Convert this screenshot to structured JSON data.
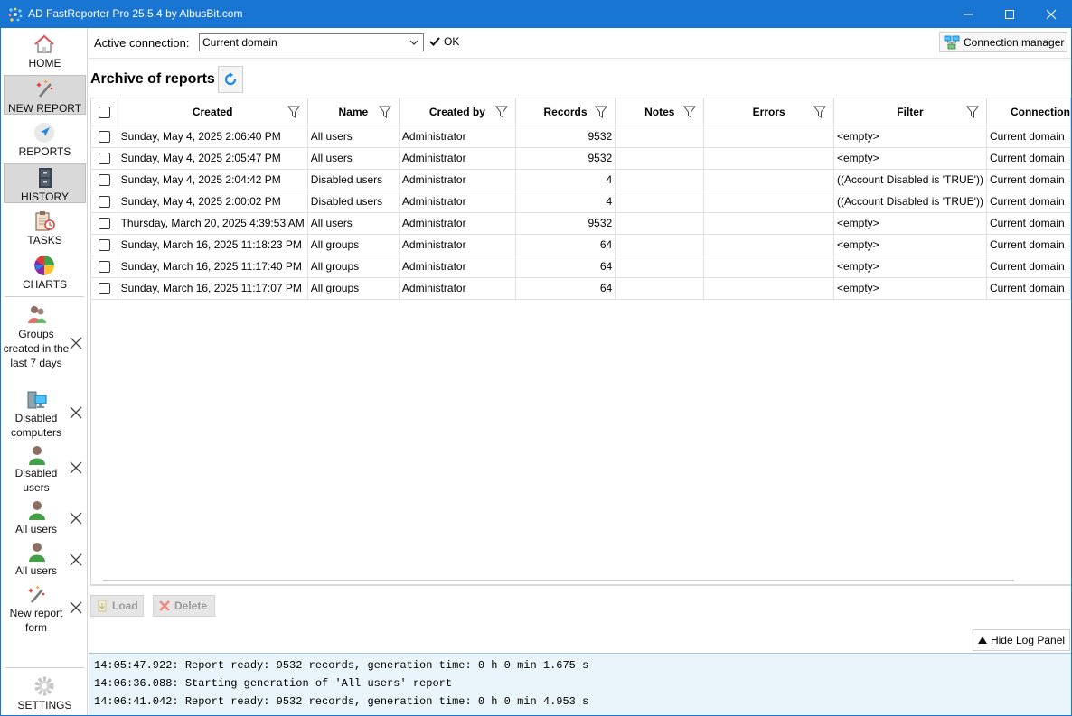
{
  "window": {
    "title": "AD FastReporter Pro 25.5.4 by AlbusBit.com"
  },
  "sidebar": {
    "nav": [
      {
        "label": "HOME",
        "icon": "home-icon",
        "active": false
      },
      {
        "label": "NEW REPORT",
        "icon": "magic-wand-icon",
        "active": true
      },
      {
        "label": "REPORTS",
        "icon": "navigation-arrow-icon",
        "active": false
      },
      {
        "label": "HISTORY",
        "icon": "file-cabinet-icon",
        "active": true
      },
      {
        "label": "TASKS",
        "icon": "clipboard-clock-icon",
        "active": false
      },
      {
        "label": "CHARTS",
        "icon": "pie-chart-icon",
        "active": false
      }
    ],
    "recent": [
      {
        "label": "Groups created in the last 7 days",
        "icon": "group-users-icon"
      },
      {
        "label": "Disabled computers",
        "icon": "computer-icon"
      },
      {
        "label": "Disabled users",
        "icon": "user-icon"
      },
      {
        "label": "All users",
        "icon": "user-icon"
      },
      {
        "label": "All users",
        "icon": "user-icon"
      },
      {
        "label": "New report form",
        "icon": "magic-wand-icon"
      }
    ],
    "settings_label": "SETTINGS"
  },
  "connection": {
    "label": "Active connection:",
    "value": "Current domain",
    "status": "OK",
    "manager_label": "Connection manager"
  },
  "archive": {
    "title": "Archive of reports"
  },
  "grid": {
    "columns": [
      "Created",
      "Name",
      "Created by",
      "Records",
      "Notes",
      "Errors",
      "Filter",
      "Connection"
    ],
    "rows": [
      {
        "created": "Sunday, May 4, 2025 2:06:40 PM",
        "name": "All users",
        "created_by": "Administrator",
        "records": "9532",
        "notes": "",
        "errors": "",
        "filter": "<empty>",
        "connection": "Current domain"
      },
      {
        "created": "Sunday, May 4, 2025 2:05:47 PM",
        "name": "All users",
        "created_by": "Administrator",
        "records": "9532",
        "notes": "",
        "errors": "",
        "filter": "<empty>",
        "connection": "Current domain"
      },
      {
        "created": "Sunday, May 4, 2025 2:04:42 PM",
        "name": "Disabled users",
        "created_by": "Administrator",
        "records": "4",
        "notes": "",
        "errors": "",
        "filter": "((Account Disabled is 'TRUE'))",
        "connection": "Current domain"
      },
      {
        "created": "Sunday, May 4, 2025 2:00:02 PM",
        "name": "Disabled users",
        "created_by": "Administrator",
        "records": "4",
        "notes": "",
        "errors": "",
        "filter": "((Account Disabled is 'TRUE'))",
        "connection": "Current domain"
      },
      {
        "created": "Thursday, March 20, 2025 4:39:53 AM",
        "name": "All users",
        "created_by": "Administrator",
        "records": "9532",
        "notes": "",
        "errors": "",
        "filter": "<empty>",
        "connection": "Current domain"
      },
      {
        "created": "Sunday, March 16, 2025 11:18:23 PM",
        "name": "All groups",
        "created_by": "Administrator",
        "records": "64",
        "notes": "",
        "errors": "",
        "filter": "<empty>",
        "connection": "Current domain"
      },
      {
        "created": "Sunday, March 16, 2025 11:17:40 PM",
        "name": "All groups",
        "created_by": "Administrator",
        "records": "64",
        "notes": "",
        "errors": "",
        "filter": "<empty>",
        "connection": "Current domain"
      },
      {
        "created": "Sunday, March 16, 2025 11:17:07 PM",
        "name": "All groups",
        "created_by": "Administrator",
        "records": "64",
        "notes": "",
        "errors": "",
        "filter": "<empty>",
        "connection": "Current domain"
      }
    ]
  },
  "actions": {
    "load_label": "Load",
    "delete_label": "Delete"
  },
  "log": {
    "toggle_label": "Hide Log Panel",
    "lines": [
      "14:05:47.922: Report ready: 9532 records, generation time: 0 h 0 min 1.675 s",
      "14:06:36.088: Starting generation of 'All users' report",
      "14:06:41.042: Report ready: 9532 records, generation time: 0 h 0 min 4.953 s"
    ]
  },
  "colors": {
    "titlebar": "#1875d1",
    "log_bg": "#eaf4fb",
    "nav_active_bg": "#d9d9d9"
  }
}
